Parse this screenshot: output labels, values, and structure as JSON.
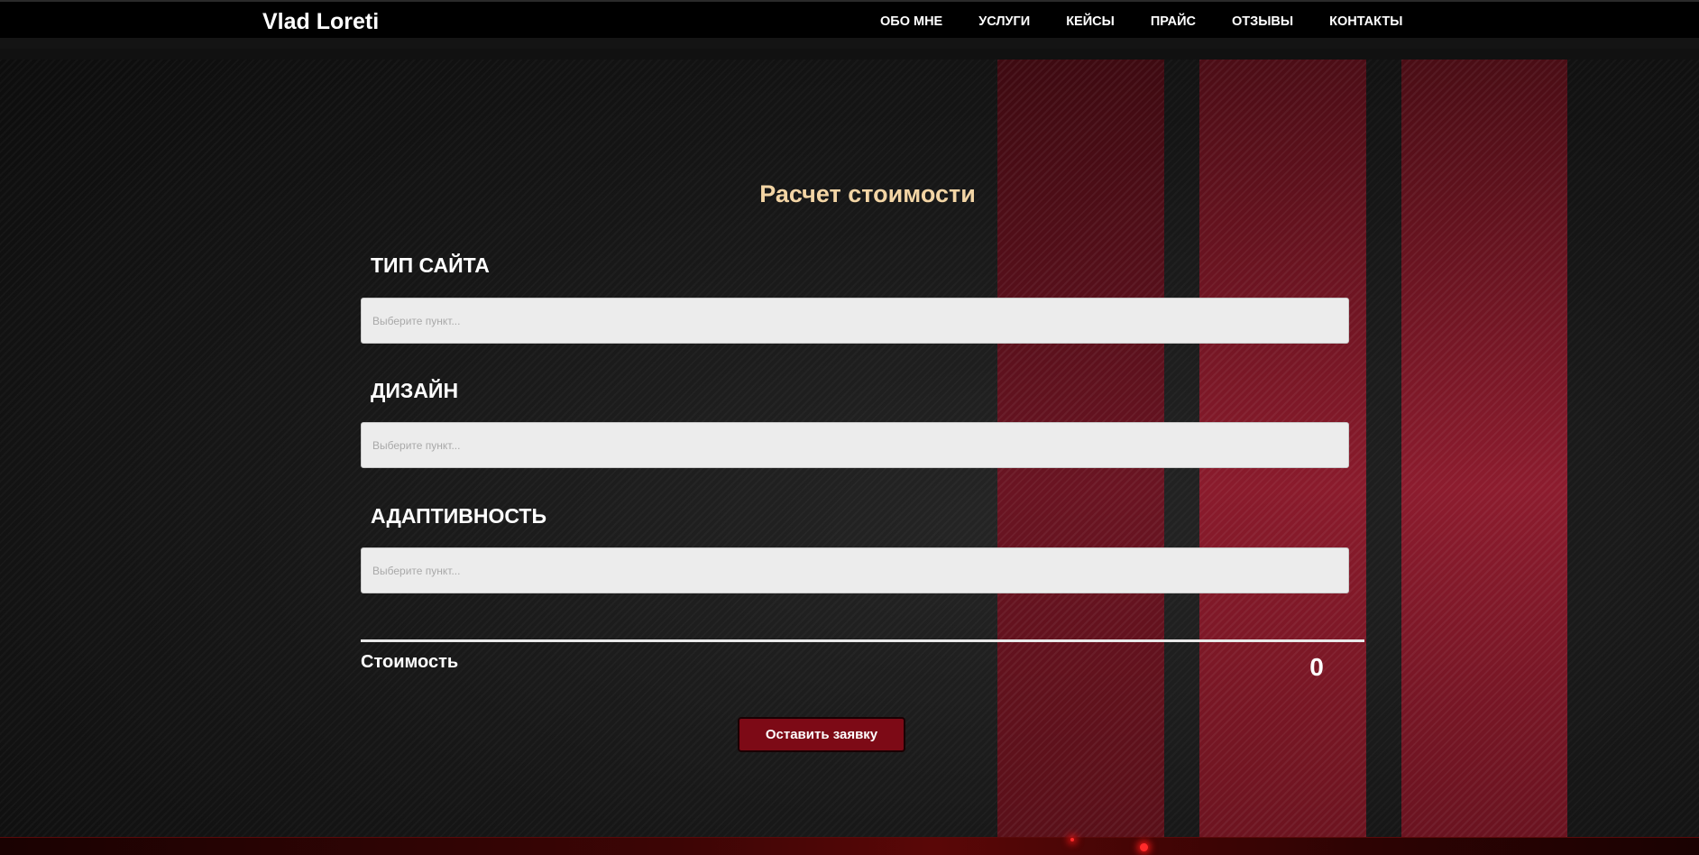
{
  "header": {
    "brand": "Vlad Loreti",
    "nav": [
      "ОБО МНЕ",
      "УСЛУГИ",
      "КЕЙСЫ",
      "ПРАЙС",
      "ОТЗЫВЫ",
      "КОНТАКТЫ"
    ]
  },
  "calculator": {
    "title": "Расчет стоимости",
    "fields": [
      {
        "label": "ТИП САЙТА",
        "placeholder": "Выберите пункт..."
      },
      {
        "label": "ДИЗАЙН",
        "placeholder": "Выберите пункт..."
      },
      {
        "label": "АДАПТИВНОСТЬ",
        "placeholder": "Выберите пункт..."
      }
    ],
    "cost_label": "Стоимость",
    "cost_value": "0",
    "submit_label": "Оставить заявку"
  },
  "colors": {
    "title_accent": "#f3d5a5",
    "button_bg": "#7d0a16",
    "stripe_red": "#8a1b2c"
  }
}
